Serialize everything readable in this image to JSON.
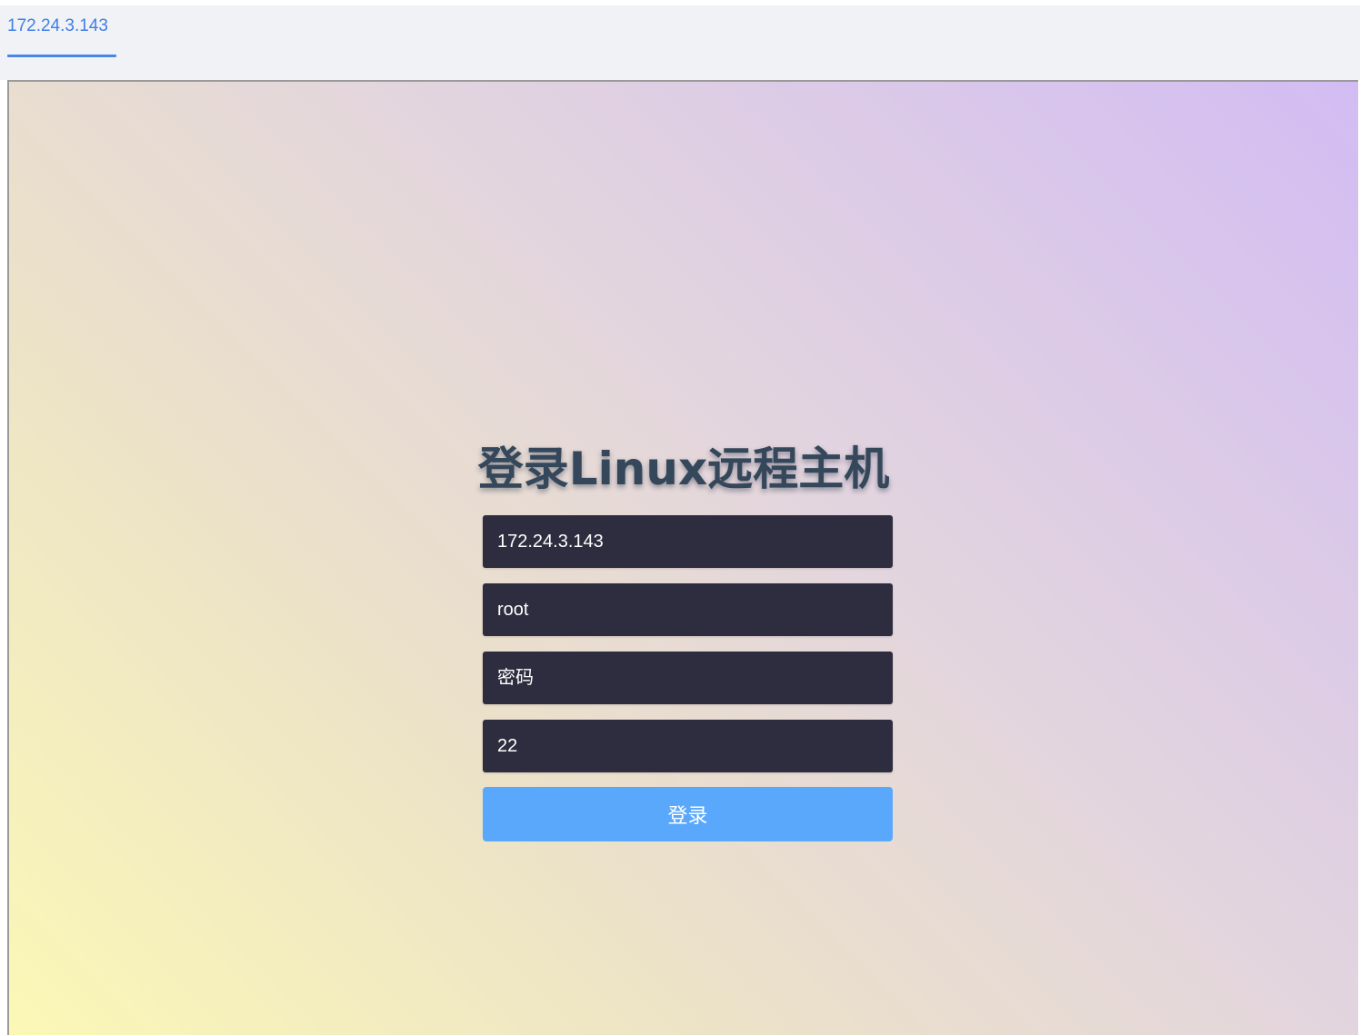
{
  "tabs": [
    {
      "label": "172.24.3.143",
      "active": true
    }
  ],
  "login": {
    "title": "登录Linux远程主机",
    "host_value": "172.24.3.143",
    "username_value": "root",
    "password_placeholder": "密码",
    "port_value": "22",
    "submit_label": "登录"
  },
  "colors": {
    "accent": "#4a86e8",
    "input_bg": "#2d2d3f",
    "button": "#5aa8fc",
    "title": "#35475a"
  }
}
